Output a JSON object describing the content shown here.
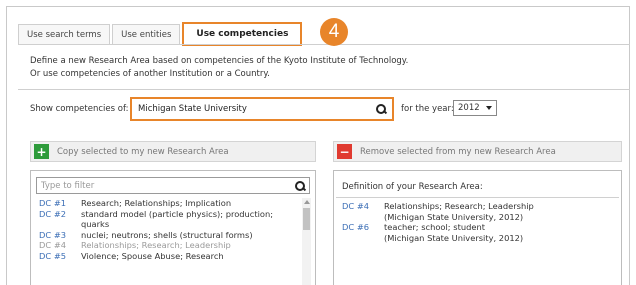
{
  "tabs": [
    {
      "label": "Use search terms"
    },
    {
      "label": "Use entities"
    },
    {
      "label": "Use competencies"
    }
  ],
  "step_badge": "4",
  "description": {
    "line1": "Define a new Research Area based on competencies of the Kyoto Institute of Technology.",
    "line2": "Or use competencies of another Institution or a Country."
  },
  "show_competencies": {
    "label": "Show competencies of:",
    "value": "Michigan State University"
  },
  "year": {
    "label": "for the year:",
    "value": "2012"
  },
  "buttons": {
    "copy": "Copy selected to my new Research Area",
    "remove": "Remove selected from my new Research Area"
  },
  "filter": {
    "placeholder": "Type to filter"
  },
  "left_list": [
    {
      "code": "DC #1",
      "text": "Research; Relationships; Implication"
    },
    {
      "code": "DC #2",
      "text": "standard model (particle physics); production; quarks"
    },
    {
      "code": "DC #3",
      "text": "nuclei; neutrons; shells (structural forms)"
    },
    {
      "code": "DC #4",
      "text": "Relationships; Research; Leadership"
    },
    {
      "code": "DC #5",
      "text": "Violence; Spouse Abuse; Research"
    }
  ],
  "definition": {
    "title": "Definition of your Research Area:",
    "items": [
      {
        "code": "DC #4",
        "text": "Relationships; Research; Leadership",
        "source": "(Michigan State University, 2012)"
      },
      {
        "code": "DC #6",
        "text": "teacher; school; student",
        "source": "(Michigan State University, 2012)"
      }
    ]
  },
  "colors": {
    "accent": "#e8852a",
    "link": "#3a6db5",
    "add": "#2e9b3b",
    "remove": "#e03a30"
  }
}
